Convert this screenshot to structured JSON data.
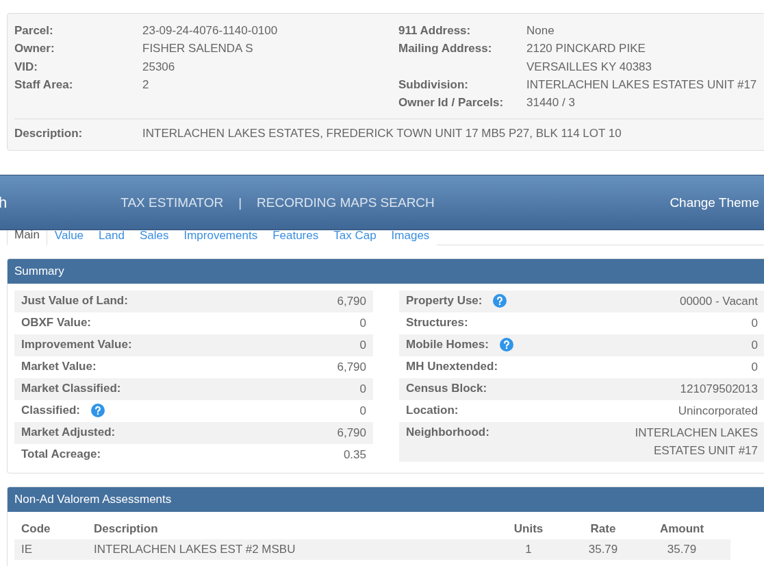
{
  "parcel_info": {
    "left": [
      {
        "label": "Parcel:",
        "values": [
          "23-09-24-4076-1140-0100"
        ]
      },
      {
        "label": "Owner:",
        "values": [
          "FISHER SALENDA S"
        ]
      },
      {
        "label": "VID:",
        "values": [
          "25306"
        ]
      },
      {
        "label": "Staff Area:",
        "values": [
          "2"
        ]
      }
    ],
    "right": [
      {
        "label": "911 Address:",
        "values": [
          "None"
        ]
      },
      {
        "label": "Mailing Address:",
        "values": [
          "2120 PINCKARD PIKE",
          "VERSAILLES KY 40383"
        ]
      },
      {
        "label": "Subdivision:",
        "values": [
          "INTERLACHEN LAKES ESTATES UNIT #17"
        ]
      },
      {
        "label": "Owner Id / Parcels:",
        "values": [
          "31440 / 3"
        ]
      }
    ],
    "description": {
      "label": "Description:",
      "value": "INTERLACHEN LAKES ESTATES, FREDERICK TOWN UNIT 17 MB5 P27, BLK 114 LOT 10"
    }
  },
  "navbar": {
    "brand": "h",
    "links": [
      "TAX ESTIMATOR",
      "RECORDING MAPS SEARCH"
    ],
    "separator": "|",
    "theme_link": "Change Theme"
  },
  "tabs": [
    {
      "label": "Main",
      "selected": true
    },
    {
      "label": "Value",
      "selected": false
    },
    {
      "label": "Land",
      "selected": false
    },
    {
      "label": "Sales",
      "selected": false
    },
    {
      "label": "Improvements",
      "selected": false
    },
    {
      "label": "Features",
      "selected": false
    },
    {
      "label": "Tax Cap",
      "selected": false
    },
    {
      "label": "Images",
      "selected": false
    }
  ],
  "summary": {
    "title": "Summary",
    "left": [
      {
        "label": "Just Value of Land:",
        "value": "6,790",
        "help": false
      },
      {
        "label": "OBXF Value:",
        "value": "0",
        "help": false
      },
      {
        "label": "Improvement Value:",
        "value": "0",
        "help": false
      },
      {
        "label": "Market Value:",
        "value": "6,790",
        "help": false
      },
      {
        "label": "Market Classified:",
        "value": "0",
        "help": false
      },
      {
        "label": "Classified:",
        "value": "0",
        "help": true
      },
      {
        "label": "Market Adjusted:",
        "value": "6,790",
        "help": false
      },
      {
        "label": "Total Acreage:",
        "value": "0.35",
        "help": false
      }
    ],
    "right": [
      {
        "label": "Property Use:",
        "value": "00000 - Vacant",
        "help": true
      },
      {
        "label": "Structures:",
        "value": "0",
        "help": false
      },
      {
        "label": "Mobile Homes:",
        "value": "0",
        "help": true
      },
      {
        "label": "MH Unextended:",
        "value": "0",
        "help": false
      },
      {
        "label": "Census Block:",
        "value": "121079502013",
        "help": false
      },
      {
        "label": "Location:",
        "value": "Unincorporated",
        "help": false
      },
      {
        "label": "Neighborhood:",
        "value": "INTERLACHEN LAKES ESTATES UNIT #17",
        "help": false
      }
    ]
  },
  "assessments": {
    "title": "Non-Ad Valorem Assessments",
    "columns": [
      "Code",
      "Description",
      "Units",
      "Rate",
      "Amount"
    ],
    "rows": [
      [
        "IE",
        "INTERLACHEN LAKES EST #2 MSBU",
        "1",
        "35.79",
        "35.79"
      ]
    ]
  }
}
